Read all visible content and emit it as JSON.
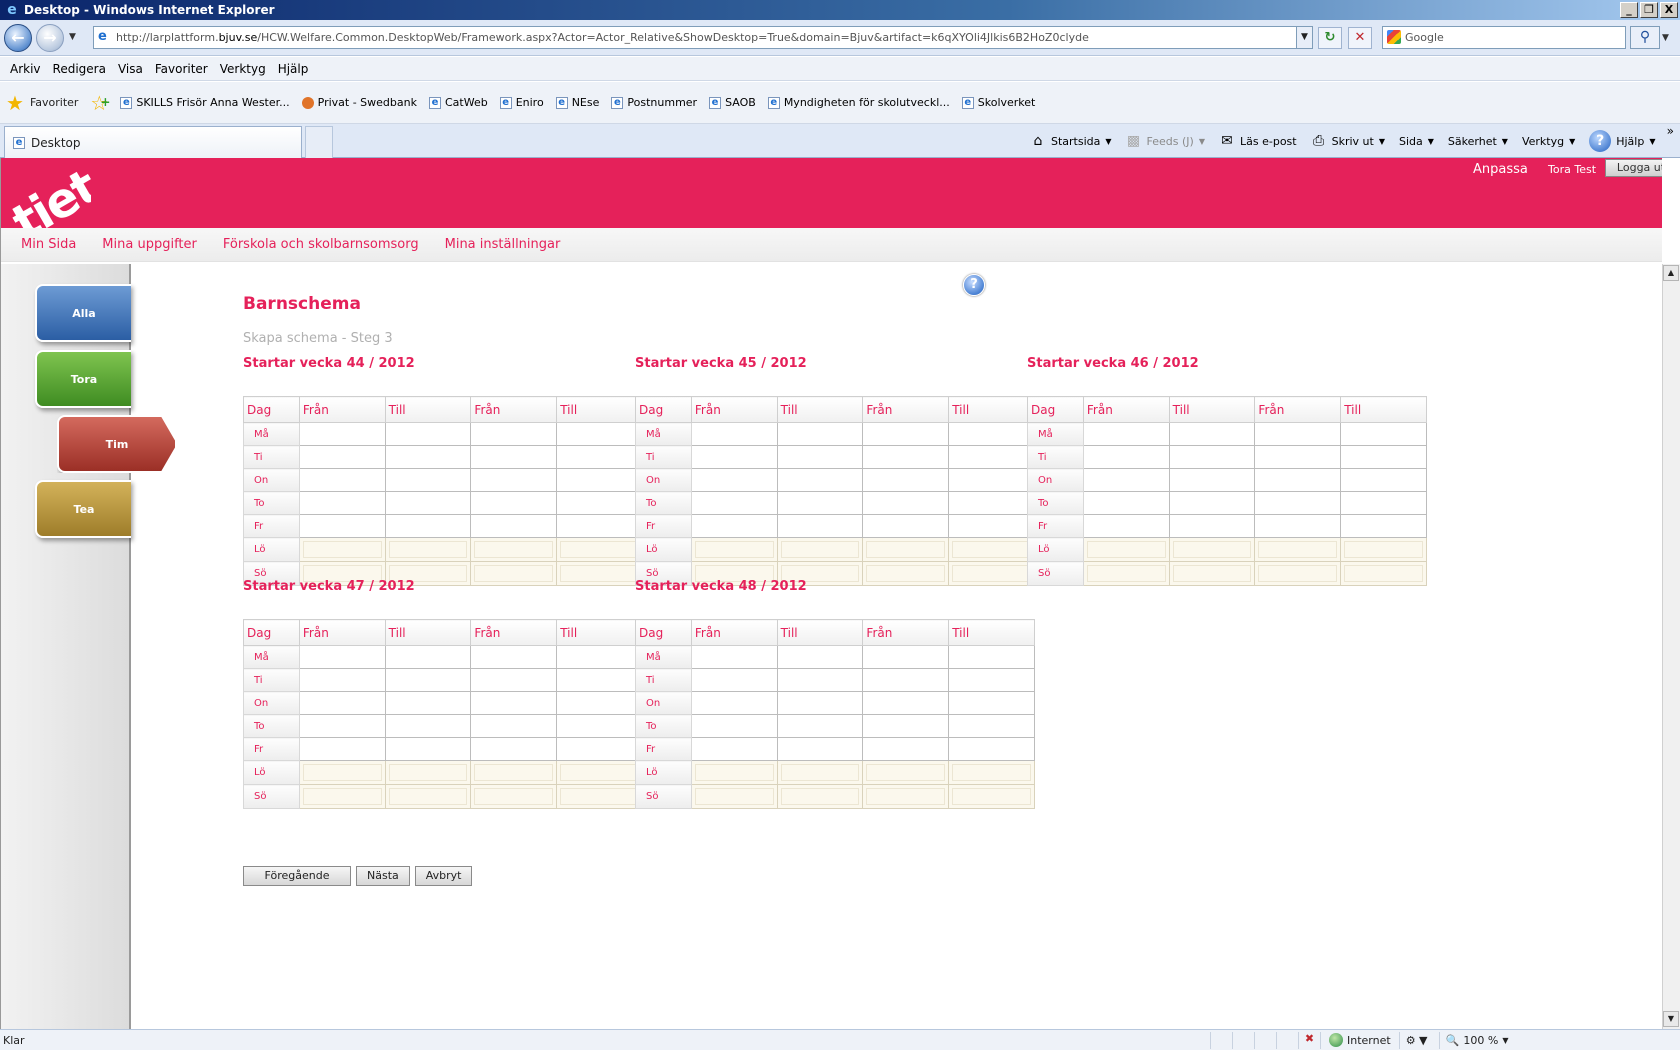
{
  "window": {
    "title": "Desktop - Windows Internet Explorer",
    "buttons": [
      "_",
      "❐",
      "X"
    ]
  },
  "address": {
    "url_prefix": "http://larplattform.",
    "url_host": "bjuv.se",
    "url_rest": "/HCW.Welfare.Common.DesktopWeb/Framework.aspx?Actor=Actor_Relative&ShowDesktop=True&domain=Bjuv&artifact=k6qXYOli4Jlkis6B2HoZ0clyde",
    "search_placeholder": "Google"
  },
  "menu": [
    "Arkiv",
    "Redigera",
    "Visa",
    "Favoriter",
    "Verktyg",
    "Hjälp"
  ],
  "favorites": {
    "label": "Favoriter",
    "items": [
      "SKILLS  Frisör Anna Wester...",
      "Privat - Swedbank",
      "CatWeb",
      "Eniro",
      "NEse",
      "Postnummer",
      "SAOB",
      "Myndigheten för skolutveckl...",
      "Skolverket"
    ]
  },
  "tabs": {
    "active": "Desktop"
  },
  "commands": {
    "home": "Startsida",
    "feeds": "Feeds (J)",
    "mail": "Läs e-post",
    "print": "Skriv ut",
    "page": "Sida",
    "safety": "Säkerhet",
    "tools": "Verktyg",
    "help": "Hjälp"
  },
  "header": {
    "logo": "tieto",
    "anpassa": "Anpassa",
    "user": "Tora Test",
    "logout": "Logga ut"
  },
  "nav": [
    "Min Sida",
    "Mina uppgifter",
    "Förskola och skolbarnsomsorg",
    "Mina inställningar"
  ],
  "children": {
    "alla": "Alla",
    "tora": "Tora",
    "tim": "Tim",
    "tea": "Tea"
  },
  "page": {
    "title": "Barnschema",
    "subtitle": "Skapa schema - Steg 3",
    "help": "?"
  },
  "schedule": {
    "headers": [
      "Dag",
      "Från",
      "Till",
      "Från",
      "Till"
    ],
    "days": [
      "Må",
      "Ti",
      "On",
      "To",
      "Fr",
      "Lö",
      "Sö"
    ],
    "weeks": [
      "Startar vecka 44 / 2012",
      "Startar vecka 45 / 2012",
      "Startar vecka 46 / 2012",
      "Startar vecka 47 / 2012",
      "Startar vecka 48 / 2012"
    ]
  },
  "buttons": {
    "prev": "Föregående",
    "next": "Nästa",
    "cancel": "Avbryt"
  },
  "status": {
    "text": "Klar",
    "zone": "Internet",
    "zoom": "100 %"
  },
  "colors": {
    "brand": "#e5215a",
    "alla": "#2b5ea4",
    "tora": "#3f8c22",
    "tim": "#9b2f26",
    "tea": "#9e7d2a"
  }
}
